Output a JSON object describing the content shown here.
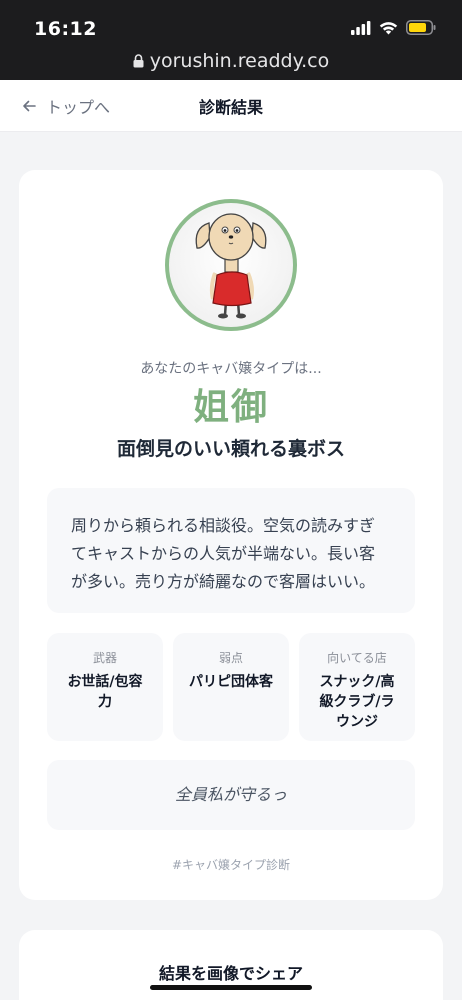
{
  "status_bar": {
    "time": "16:12",
    "url": "yorushin.readdy.co"
  },
  "nav": {
    "back_label": "トップへ",
    "title": "診断結果"
  },
  "result": {
    "lead": "あなたのキャバ嬢タイプは...",
    "type_name": "姐御",
    "subtitle": "面倒見のいい頼れる裏ボス",
    "description_lines": [
      "周りから頼られる相談役。空気の読みすぎ",
      "てキャストからの人気が半端ない。長い客",
      "が多い。売り方が綺麗なので客層はいい。"
    ],
    "attributes": [
      {
        "label": "武器",
        "value_lines": [
          "お世話/包容",
          "力"
        ]
      },
      {
        "label": "弱点",
        "value_lines": [
          "パリピ団体客"
        ]
      },
      {
        "label": "向いてる店",
        "value_lines": [
          "スナック/高",
          "級クラブ/ラ",
          "ウンジ"
        ]
      }
    ],
    "quote": "全員私が守るっ",
    "hashtag": "#キャバ嬢タイプ診断"
  },
  "share": {
    "title": "結果を画像でシェア"
  },
  "colors": {
    "accent": "#7fb07f",
    "avatar_ring": "#8cbc8c",
    "dress": "#d92b2b",
    "battery": "#ffd60a"
  },
  "icons": [
    "lock-icon",
    "back-arrow-icon",
    "signal-icon",
    "wifi-icon",
    "battery-icon"
  ]
}
